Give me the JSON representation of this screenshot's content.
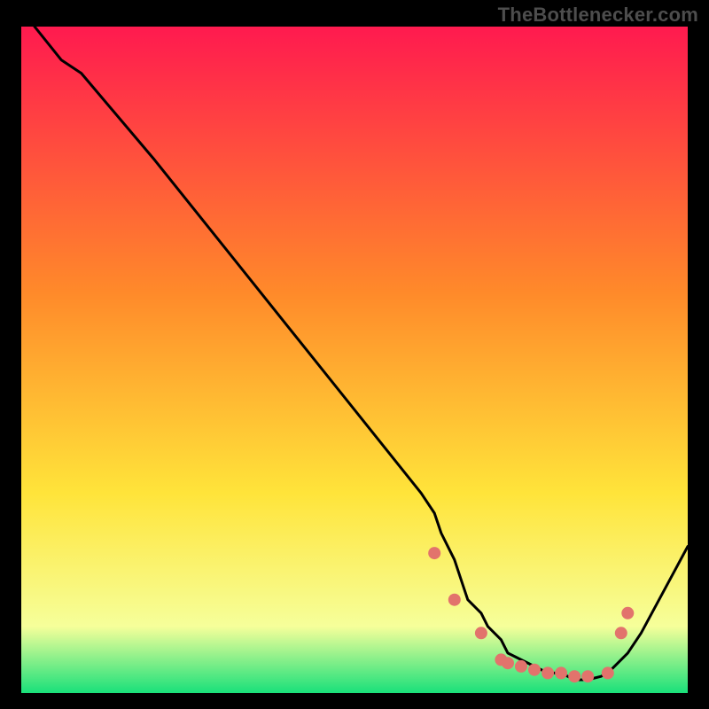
{
  "attribution": "TheBottlenecker.com",
  "chart_data": {
    "type": "line",
    "title": "",
    "xlabel": "",
    "ylabel": "",
    "xlim": [
      0,
      100
    ],
    "ylim": [
      0,
      100
    ],
    "background_gradient": {
      "top": "#ff1a4f",
      "mid_upper": "#ff8a2a",
      "mid": "#ffe43a",
      "lower_band": "#f6ff9a",
      "bottom": "#19e07a"
    },
    "series": [
      {
        "name": "bottleneck-curve",
        "color": "#000000",
        "x": [
          2,
          6,
          9,
          20,
          40,
          60,
          62,
          63,
          65,
          66,
          67,
          69,
          70,
          72,
          73,
          75,
          77,
          79,
          81,
          83,
          85,
          87,
          88,
          89,
          90,
          91,
          93,
          100
        ],
        "y": [
          100,
          95,
          93,
          80,
          55,
          30,
          27,
          24,
          20,
          17,
          14,
          12,
          10,
          8,
          6,
          5,
          4,
          3,
          3,
          2,
          2,
          2.5,
          3,
          4,
          5,
          6,
          9,
          22
        ]
      }
    ],
    "marker_points": {
      "name": "highlight-dots",
      "color": "#e2736c",
      "radius": 7,
      "x": [
        62,
        65,
        69,
        72,
        73,
        75,
        77,
        79,
        81,
        83,
        85,
        88,
        90,
        91
      ],
      "y": [
        21,
        14,
        9,
        5,
        4.5,
        4,
        3.5,
        3,
        3,
        2.5,
        2.5,
        3,
        9,
        12
      ]
    }
  }
}
